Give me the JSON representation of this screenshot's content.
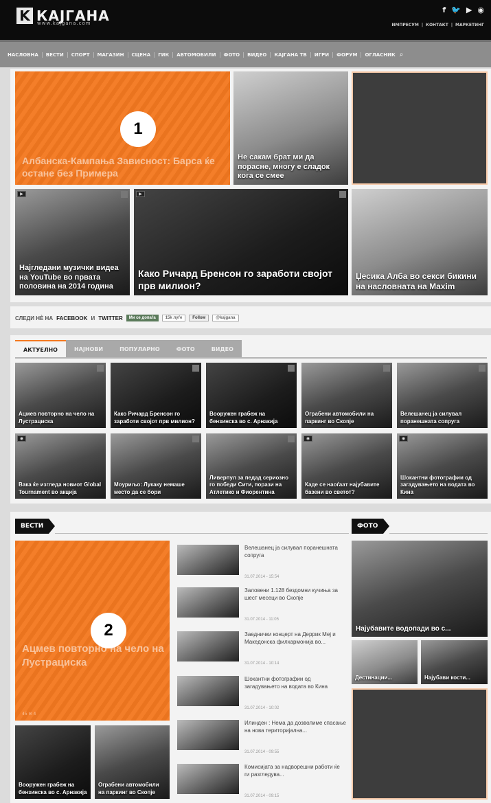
{
  "header": {
    "logo_mark": "K",
    "logo_text": "КАЈГАНА",
    "logo_url": "www.kajgana.com",
    "social": [
      "f",
      "🐦",
      "▶",
      "◉"
    ],
    "top_links": [
      "ИМПРЕСУМ",
      "|",
      "КОНТАКТ",
      "|",
      "МАРКЕТИНГ"
    ]
  },
  "nav": {
    "items": [
      "НАСЛОВНА",
      "ВЕСТИ",
      "СПОРТ",
      "МАГАЗИН",
      "СЦЕНА",
      "ГИК",
      "АВТОМОБИЛИ",
      "ФОТО",
      "ВИДЕО",
      "КАЈГАНА ТВ",
      "ИГРИ",
      "ФОРУМ",
      "ОГЛАСНИК"
    ],
    "search_icon": "⌕"
  },
  "hero": {
    "orange_caption": "Албанска-Кампања Зависност: Барса ќе остане без Примера",
    "marker_1": "1",
    "child_caption": "Не сакам брат ми да порасне, многу е сладок кога се смее"
  },
  "row2": {
    "left_caption": "Најгледани музички видеа на YouTube во првата половина на 2014 година",
    "mid_caption": "Како Ричард Бренсон го заработи својот прв милион?",
    "right_caption": "Џесика Алба во секси бикини на насловната на Maxim"
  },
  "follow": {
    "label_prefix": "СЛЕДИ НÈ НА",
    "label_facebook": "FACEBOOK",
    "label_and": "И",
    "label_twitter": "TWITTER",
    "fb_button": "Ми се допаѓа",
    "fb_count": "15k луѓе",
    "tw_button": "Follow",
    "tw_count": "@kajgana"
  },
  "tabs": [
    "АКТУЕЛНО",
    "НАЈНОВИ",
    "ПОПУЛАРНО",
    "ФОТО",
    "ВИДЕО"
  ],
  "grid_row1": [
    "Ацмев повторно на чело на Лустрациска",
    "Како Ричард Бренсон го заработи својот прв милион?",
    "Вооружен грабеж на бензинска во с. Арнакија",
    "Ограбени автомобили на паркинг во Скопје",
    "Велешанец ја силувал поранешната сопруга"
  ],
  "grid_row2": [
    "Вака ќе изгледа новиот Global Tournament во акција",
    "Моуриљо: Лукаку немаше место да се бори",
    "Ливерпул за педад сериозно го победи Сити, порази на Атлетико и Фиорентина",
    "Каде се наоѓаат најубавите базени во светот?",
    "Шокантни фотографии од загадувањето на водата во Кина"
  ],
  "vesti": {
    "header": "ВЕСТИ",
    "big_caption": "Ацмев повторно на чело на Лустрациска",
    "big_meta": "45  ✉ 4",
    "marker_2": "2",
    "list": [
      {
        "title": "Велешанец ја силувал поранешната сопруга",
        "date": "31.07.2014 - 15:54"
      },
      {
        "title": "Заловени 1.128 бездомни кучиња за шест месеци во Скопје",
        "date": "31.07.2014 - 11:05"
      },
      {
        "title": "Заеднички концерт на Деррик Меј и Македонска филхармонија во...",
        "date": "31.07.2014 - 10:14"
      },
      {
        "title": "Шокантни фотографии од загадувањето на водата во Кина",
        "date": "31.07.2014 - 10:02"
      },
      {
        "title": "Илинден : Нема да дозволиме спасање на нова територијална...",
        "date": "31.07.2014 - 09:55"
      },
      {
        "title": "Комисијата за надворешни работи ќе ги разгледува...",
        "date": "31.07.2014 - 09:15"
      }
    ],
    "small_tiles": [
      "Вооружен грабеж на бензинска во с. Арнакија",
      "Ограбени автомобили на паркинг во Скопје"
    ]
  },
  "foto": {
    "header": "ФОТО",
    "big_caption": "Најубавите водопади во с...",
    "small_tiles": [
      "Дестинации...",
      "Најубави кости..."
    ]
  }
}
